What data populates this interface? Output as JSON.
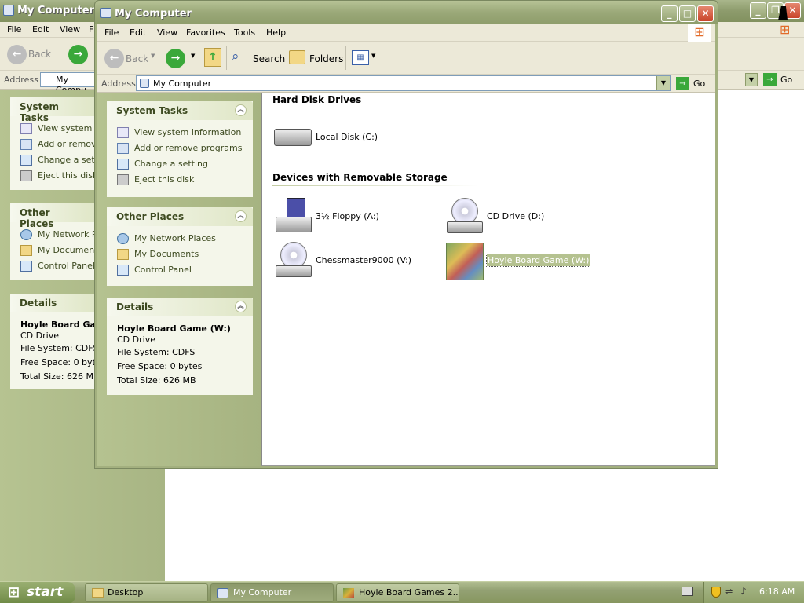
{
  "background_window": {
    "title": "My Computer",
    "menu": [
      "File",
      "Edit",
      "View",
      "F"
    ],
    "toolbar": {
      "back_label": "Back"
    },
    "address_label": "Address",
    "address_value": "My Compu",
    "go_label": "Go",
    "system_tasks": {
      "header": "System Tasks",
      "items": [
        "View system in",
        "Add or remove",
        "Change a setti",
        "Eject this disk"
      ]
    },
    "other_places": {
      "header": "Other Places",
      "items": [
        "My Network Pla",
        "My Documents",
        "Control Panel"
      ]
    },
    "details": {
      "header": "Details",
      "name": "Hoyle Board Gan",
      "type": "CD Drive",
      "file_system": "File System: CDFS",
      "free_space": "Free Space: 0 byte",
      "total_size": "Total Size: 626 MB"
    }
  },
  "window": {
    "title": "My Computer",
    "menu": [
      "File",
      "Edit",
      "View",
      "Favorites",
      "Tools",
      "Help"
    ],
    "toolbar": {
      "back_label": "Back",
      "search_label": "Search",
      "folders_label": "Folders"
    },
    "address_label": "Address",
    "address_value": "My Computer",
    "go_label": "Go",
    "system_tasks": {
      "header": "System Tasks",
      "items": [
        "View system information",
        "Add or remove programs",
        "Change a setting",
        "Eject this disk"
      ]
    },
    "other_places": {
      "header": "Other Places",
      "items": [
        "My Network Places",
        "My Documents",
        "Control Panel"
      ]
    },
    "details": {
      "header": "Details",
      "name": "Hoyle Board Game (W:)",
      "type": "CD Drive",
      "file_system": "File System: CDFS",
      "free_space": "Free Space: 0 bytes",
      "total_size": "Total Size: 626 MB"
    },
    "content": {
      "groups": [
        {
          "title": "Hard Disk Drives",
          "items": [
            "Local Disk (C:)"
          ]
        },
        {
          "title": "Devices with Removable Storage",
          "items": [
            "3½ Floppy (A:)",
            "CD Drive (D:)",
            "Chessmaster9000 (V:)",
            "Hoyle Board Game (W:)"
          ]
        }
      ],
      "selected_item": "Hoyle Board Game (W:)"
    }
  },
  "taskbar": {
    "start_label": "start",
    "buttons": [
      "Desktop",
      "My Computer",
      "Hoyle Board Games 2..."
    ],
    "active_button": "My Computer",
    "clock": "6:18 AM"
  },
  "colors": {
    "title_bar": "#9aa878",
    "task_pane": "#b5c290",
    "selection": "#316ac5"
  }
}
